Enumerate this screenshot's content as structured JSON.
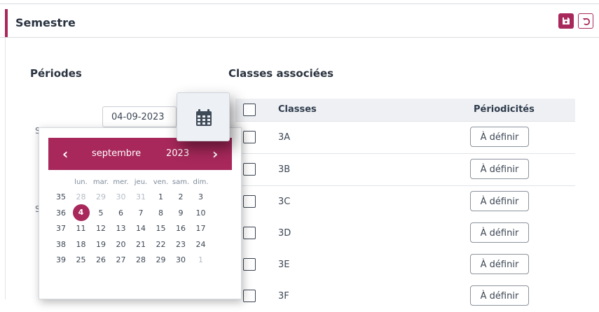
{
  "header": {
    "title": "Semestre",
    "save_icon": "save-icon",
    "undo_icon": "undo-icon",
    "accent_color": "#a8285b"
  },
  "periods": {
    "heading": "Périodes",
    "date_value": "04-09-2023",
    "label_1": "S",
    "label_2": "S",
    "calendar_icon": "calendar-icon"
  },
  "classes": {
    "heading": "Classes associées",
    "columns": {
      "classes": "Classes",
      "periodicities": "Périodicités"
    },
    "rows": [
      {
        "name": "3A",
        "action": "À définir"
      },
      {
        "name": "3B",
        "action": "À définir"
      },
      {
        "name": "3C",
        "action": "À définir"
      },
      {
        "name": "3D",
        "action": "À définir"
      },
      {
        "name": "3E",
        "action": "À définir"
      },
      {
        "name": "3F",
        "action": "À définir"
      }
    ]
  },
  "datepicker": {
    "prev": "‹",
    "next": "›",
    "month": "septembre",
    "year": "2023",
    "weekdays": [
      "lun.",
      "mar.",
      "mer.",
      "jeu.",
      "ven.",
      "sam.",
      "dim."
    ],
    "weeks": [
      {
        "week": "35",
        "days": [
          {
            "d": "28",
            "muted": true
          },
          {
            "d": "29",
            "muted": true
          },
          {
            "d": "30",
            "muted": true
          },
          {
            "d": "31",
            "muted": true
          },
          {
            "d": "1"
          },
          {
            "d": "2"
          },
          {
            "d": "3"
          }
        ]
      },
      {
        "week": "36",
        "days": [
          {
            "d": "4",
            "selected": true
          },
          {
            "d": "5"
          },
          {
            "d": "6"
          },
          {
            "d": "7"
          },
          {
            "d": "8"
          },
          {
            "d": "9"
          },
          {
            "d": "10"
          }
        ]
      },
      {
        "week": "37",
        "days": [
          {
            "d": "11"
          },
          {
            "d": "12"
          },
          {
            "d": "13"
          },
          {
            "d": "14"
          },
          {
            "d": "15"
          },
          {
            "d": "16"
          },
          {
            "d": "17"
          }
        ]
      },
      {
        "week": "38",
        "days": [
          {
            "d": "18"
          },
          {
            "d": "19"
          },
          {
            "d": "20"
          },
          {
            "d": "21"
          },
          {
            "d": "22"
          },
          {
            "d": "23"
          },
          {
            "d": "24"
          }
        ]
      },
      {
        "week": "39",
        "days": [
          {
            "d": "25"
          },
          {
            "d": "26"
          },
          {
            "d": "27"
          },
          {
            "d": "28"
          },
          {
            "d": "29"
          },
          {
            "d": "30"
          },
          {
            "d": "1",
            "muted": true
          }
        ]
      }
    ]
  }
}
